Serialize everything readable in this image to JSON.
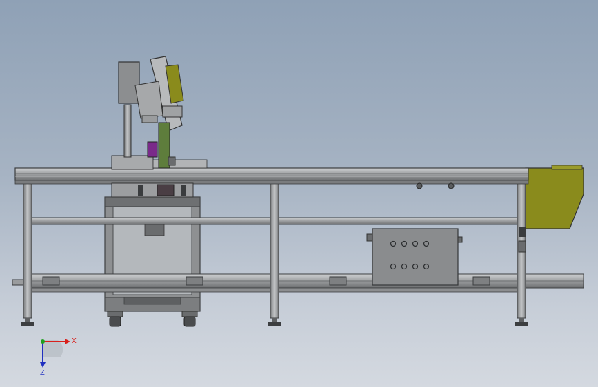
{
  "viewport": {
    "background_top": "#8fa1b6",
    "background_bottom": "#d4d9e0"
  },
  "triad": {
    "x_label": "X",
    "z_label": "Z",
    "x_color": "#d8201c",
    "z_color": "#2030c0",
    "y_color": "#20a020"
  },
  "colors": {
    "frame": "#a4a6a8",
    "frame_dark": "#6c6e70",
    "hopper": "#8a8b1c",
    "accent_purple": "#7a2a8a",
    "accent_green": "#5e7d3c",
    "control_box": "#8a8c8e"
  }
}
